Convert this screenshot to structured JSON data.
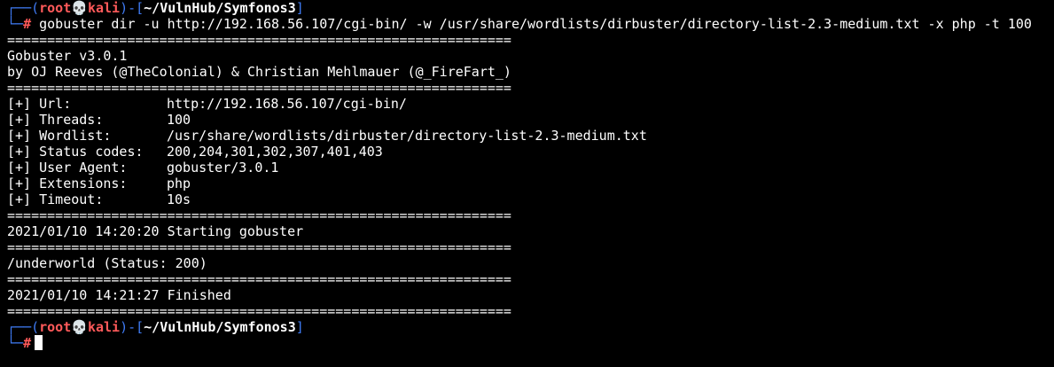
{
  "colors": {
    "background": "#000000",
    "text": "#ffffff",
    "prompt_frame": "#3f7bf4",
    "prompt_user": "#ff5a5a"
  },
  "prompt1": {
    "top": "┌──(",
    "user": "root",
    "skull_icon": "💀",
    "host": "kali",
    "mid": ")-[",
    "path": "~/VulnHub/Symfonos3",
    "end": "]",
    "bottom": "└─",
    "hash": "#",
    "command": " gobuster dir -u http://192.168.56.107/cgi-bin/ -w /usr/share/wordlists/dirbuster/directory-list-2.3-medium.txt -x php -t 100"
  },
  "separator": "===============================================================",
  "banner": {
    "version": "Gobuster v3.0.1",
    "authors": "by OJ Reeves (@TheColonial) & Christian Mehlmauer (@_FireFart_)"
  },
  "settings": [
    {
      "key": "[+] Url:",
      "value": "http://192.168.56.107/cgi-bin/"
    },
    {
      "key": "[+] Threads:",
      "value": "100"
    },
    {
      "key": "[+] Wordlist:",
      "value": "/usr/share/wordlists/dirbuster/directory-list-2.3-medium.txt"
    },
    {
      "key": "[+] Status codes:",
      "value": "200,204,301,302,307,401,403"
    },
    {
      "key": "[+] User Agent:",
      "value": "gobuster/3.0.1"
    },
    {
      "key": "[+] Extensions:",
      "value": "php"
    },
    {
      "key": "[+] Timeout:",
      "value": "10s"
    }
  ],
  "start_msg": "2021/01/10 14:20:20 Starting gobuster",
  "result": "/underworld (Status: 200)",
  "finish_msg": "2021/01/10 14:21:27 Finished",
  "prompt2": {
    "top": "┌──(",
    "user": "root",
    "skull_icon": "💀",
    "host": "kali",
    "mid": ")-[",
    "path": "~/VulnHub/Symfonos3",
    "end": "]",
    "bottom": "└─",
    "hash": "#"
  }
}
